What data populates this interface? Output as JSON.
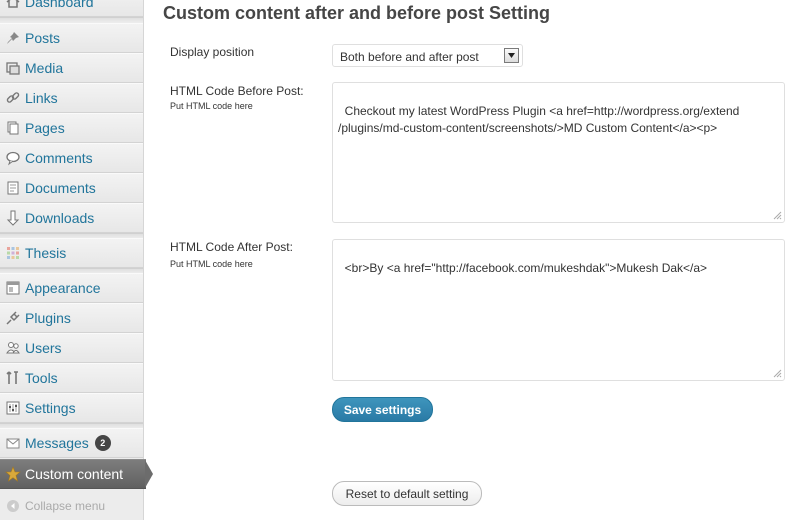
{
  "sidebar": {
    "items": [
      {
        "id": "dashboard",
        "label": "Dashboard",
        "icon": "dashboard-icon"
      },
      {
        "id": "posts",
        "label": "Posts",
        "icon": "pushpin-icon"
      },
      {
        "id": "media",
        "label": "Media",
        "icon": "media-icon"
      },
      {
        "id": "links",
        "label": "Links",
        "icon": "link-icon"
      },
      {
        "id": "pages",
        "label": "Pages",
        "icon": "pages-icon"
      },
      {
        "id": "comments",
        "label": "Comments",
        "icon": "comment-bubble-icon"
      },
      {
        "id": "documents",
        "label": "Documents",
        "icon": "document-icon"
      },
      {
        "id": "downloads",
        "label": "Downloads",
        "icon": "download-arrow-icon"
      },
      {
        "id": "thesis",
        "label": "Thesis",
        "icon": "thesis-grid-icon"
      },
      {
        "id": "appearance",
        "label": "Appearance",
        "icon": "appearance-icon"
      },
      {
        "id": "plugins",
        "label": "Plugins",
        "icon": "plug-icon"
      },
      {
        "id": "users",
        "label": "Users",
        "icon": "users-icon"
      },
      {
        "id": "tools",
        "label": "Tools",
        "icon": "tools-icon"
      },
      {
        "id": "settings",
        "label": "Settings",
        "icon": "settings-icon"
      },
      {
        "id": "messages",
        "label": "Messages",
        "icon": "envelope-icon",
        "badge": "2"
      },
      {
        "id": "custom",
        "label": "Custom content",
        "icon": "star-icon",
        "active": true
      },
      {
        "id": "collapse",
        "label": "Collapse menu",
        "icon": "collapse-arrow-icon"
      }
    ]
  },
  "main": {
    "title": "Custom content after and before post Setting",
    "display_position": {
      "label": "Display position",
      "value": "Both before and after post"
    },
    "before": {
      "label": "HTML Code Before Post:",
      "hint": "Put HTML code here",
      "value": "Checkout my latest WordPress Plugin <a href=http://wordpress.org/extend\n/plugins/md-custom-content/screenshots/>MD Custom Content</a><p>"
    },
    "after": {
      "label": "HTML Code After Post:",
      "hint": "Put HTML code here",
      "value": "<br>By <a href=\"http://facebook.com/mukeshdak\">Mukesh Dak</a>"
    },
    "save_label": "Save settings",
    "reset_label": "Reset to default setting"
  },
  "colors": {
    "link": "#21759b",
    "primary_button": "#2a7aa5",
    "active_menu": "#6c6c6c"
  }
}
